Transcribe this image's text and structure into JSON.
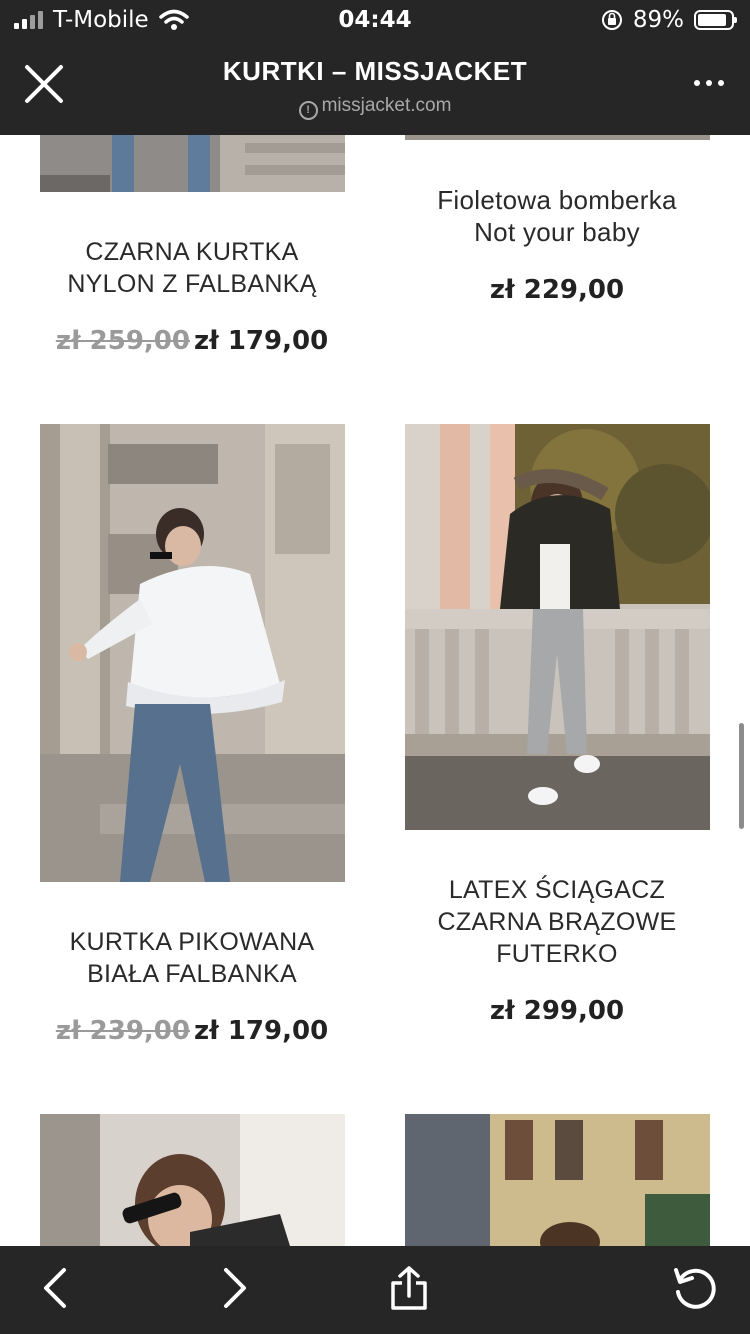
{
  "status_bar": {
    "carrier": "T-Mobile",
    "time": "04:44",
    "battery": "89%",
    "icons": [
      "signal-icon",
      "wifi-icon",
      "orientation-lock-icon",
      "battery-icon"
    ]
  },
  "header": {
    "title": "KURTKI – MISSJACKET",
    "domain": "missjacket.com",
    "icons": [
      "close-icon",
      "info-icon",
      "more-icon"
    ]
  },
  "products": [
    {
      "title_lines": [
        "CZARNA KURTKA",
        "NYLON Z FALBANKĄ"
      ],
      "old_price": "zł 259,00",
      "price": "zł 179,00"
    },
    {
      "title_lines": [
        "Fioletowa bomberka",
        "Not your baby"
      ],
      "old_price": "",
      "price": "zł 229,00"
    },
    {
      "title_lines": [
        "KURTKA PIKOWANA",
        "BIAŁA FALBANKA"
      ],
      "old_price": "zł 239,00",
      "price": "zł 179,00"
    },
    {
      "title_lines": [
        "LATEX ŚCIĄGACZ",
        "CZARNA BRĄZOWE",
        "FUTERKO"
      ],
      "old_price": "",
      "price": "zł 299,00"
    }
  ],
  "toolbar": {
    "icons": [
      "back-icon",
      "forward-icon",
      "share-icon",
      "reload-icon"
    ]
  },
  "colors": {
    "bar_background": "#262626",
    "text": "#222222",
    "old_price": "#9a9a9a"
  }
}
